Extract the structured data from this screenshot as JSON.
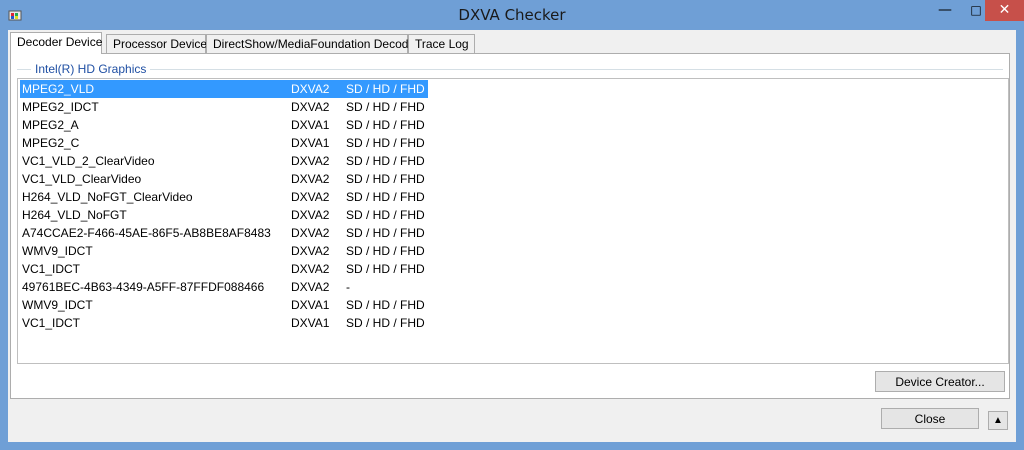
{
  "window": {
    "title": "DXVA Checker",
    "minimize": "—",
    "maximize": "□",
    "close": "✕"
  },
  "tabs": [
    {
      "label": "Decoder Device"
    },
    {
      "label": "Processor Device"
    },
    {
      "label": "DirectShow/MediaFoundation Decoder"
    },
    {
      "label": "Trace Log"
    }
  ],
  "group": {
    "label": "Intel(R) HD Graphics"
  },
  "rows": [
    {
      "name": "MPEG2_VLD",
      "api": "DXVA2",
      "res": "SD / HD / FHD",
      "selected": true
    },
    {
      "name": "MPEG2_IDCT",
      "api": "DXVA2",
      "res": "SD / HD / FHD"
    },
    {
      "name": "MPEG2_A",
      "api": "DXVA1",
      "res": "SD / HD / FHD"
    },
    {
      "name": "MPEG2_C",
      "api": "DXVA1",
      "res": "SD / HD / FHD"
    },
    {
      "name": "VC1_VLD_2_ClearVideo",
      "api": "DXVA2",
      "res": "SD / HD / FHD"
    },
    {
      "name": "VC1_VLD_ClearVideo",
      "api": "DXVA2",
      "res": "SD / HD / FHD"
    },
    {
      "name": "H264_VLD_NoFGT_ClearVideo",
      "api": "DXVA2",
      "res": "SD / HD / FHD"
    },
    {
      "name": "H264_VLD_NoFGT",
      "api": "DXVA2",
      "res": "SD / HD / FHD"
    },
    {
      "name": "A74CCAE2-F466-45AE-86F5-AB8BE8AF8483",
      "api": "DXVA2",
      "res": "SD / HD / FHD"
    },
    {
      "name": "WMV9_IDCT",
      "api": "DXVA2",
      "res": "SD / HD / FHD"
    },
    {
      "name": "VC1_IDCT",
      "api": "DXVA2",
      "res": "SD / HD / FHD"
    },
    {
      "name": "49761BEC-4B63-4349-A5FF-87FFDF088466",
      "api": "DXVA2",
      "res": "-"
    },
    {
      "name": "WMV9_IDCT",
      "api": "DXVA1",
      "res": "SD / HD / FHD"
    },
    {
      "name": "VC1_IDCT",
      "api": "DXVA1",
      "res": "SD / HD / FHD"
    }
  ],
  "buttons": {
    "device_creator": "Device Creator...",
    "close": "Close",
    "expand": "▲"
  },
  "colors": {
    "selection": "#3399ff",
    "group_label": "#1f4fa3",
    "titlebar": "#6f9fd6",
    "close_button": "#c7504a"
  }
}
